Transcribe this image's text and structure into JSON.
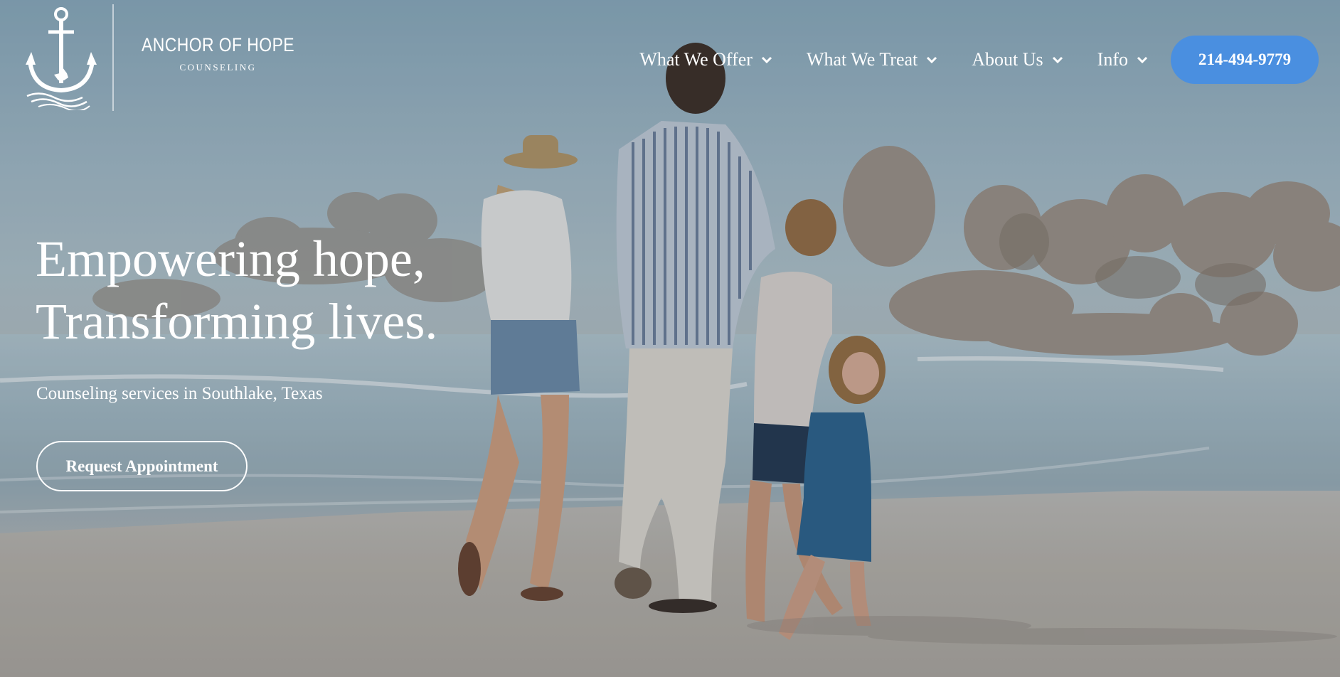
{
  "brand": {
    "name": "ANCHOR OF HOPE",
    "tagline": "COUNSELING",
    "logo_icon": "anchor-icon"
  },
  "nav": {
    "items": [
      {
        "label": "What We Offer",
        "icon": "chevron-down-icon"
      },
      {
        "label": "What We Treat",
        "icon": "chevron-down-icon"
      },
      {
        "label": "About Us",
        "icon": "chevron-down-icon"
      },
      {
        "label": "Info",
        "icon": "chevron-down-icon"
      }
    ],
    "phone": "214-494-9779"
  },
  "hero": {
    "headline_line1": "Empowering hope,",
    "headline_line2": "Transforming lives.",
    "subheading": "Counseling services in Southlake, Texas",
    "cta_label": "Request Appointment",
    "image_description": "family walking on beach"
  },
  "colors": {
    "accent": "#4a8fe0",
    "text": "#ffffff"
  }
}
